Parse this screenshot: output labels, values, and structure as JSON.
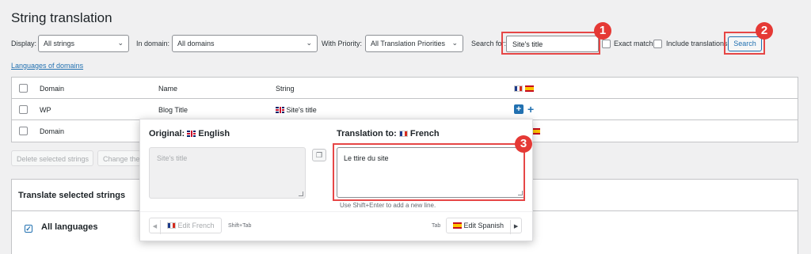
{
  "page": {
    "title": "String translation"
  },
  "filters": {
    "display_label": "Display:",
    "display_value": "All strings",
    "domain_label": "In domain:",
    "domain_value": "All domains",
    "priority_label": "With Priority:",
    "priority_value": "All Translation Priorities",
    "search_label": "Search for:",
    "search_value": "Site's title",
    "exact_match_label": "Exact match",
    "include_translations_label": "Include translations",
    "search_button": "Search"
  },
  "links": {
    "languages_of_domains": "Languages of domains"
  },
  "table": {
    "headers": {
      "domain": "Domain",
      "name": "Name",
      "string": "String"
    },
    "rows": [
      {
        "domain": "WP",
        "name": "Blog Title",
        "string": "Site's title"
      },
      {
        "domain": "Domain"
      }
    ]
  },
  "bulk": {
    "delete_label": "Delete selected strings",
    "change_label": "Change the"
  },
  "translate_panel": {
    "title": "Translate selected strings",
    "all_languages": "All languages"
  },
  "popup": {
    "original_label": "Original:",
    "original_language": "English",
    "original_text": "Site's title",
    "translation_label": "Translation to:",
    "translation_language": "French",
    "translation_text": "Le ttire du site",
    "hint": "Use Shift+Enter to add a new line.",
    "prev_label": "Edit French",
    "prev_key": "Shift+Tab",
    "next_key": "Tab",
    "next_label": "Edit Spanish"
  },
  "annotations": {
    "badge1": "1",
    "badge2": "2",
    "badge3": "3"
  },
  "colors": {
    "accent": "#2271b1",
    "highlight": "#e64646"
  }
}
